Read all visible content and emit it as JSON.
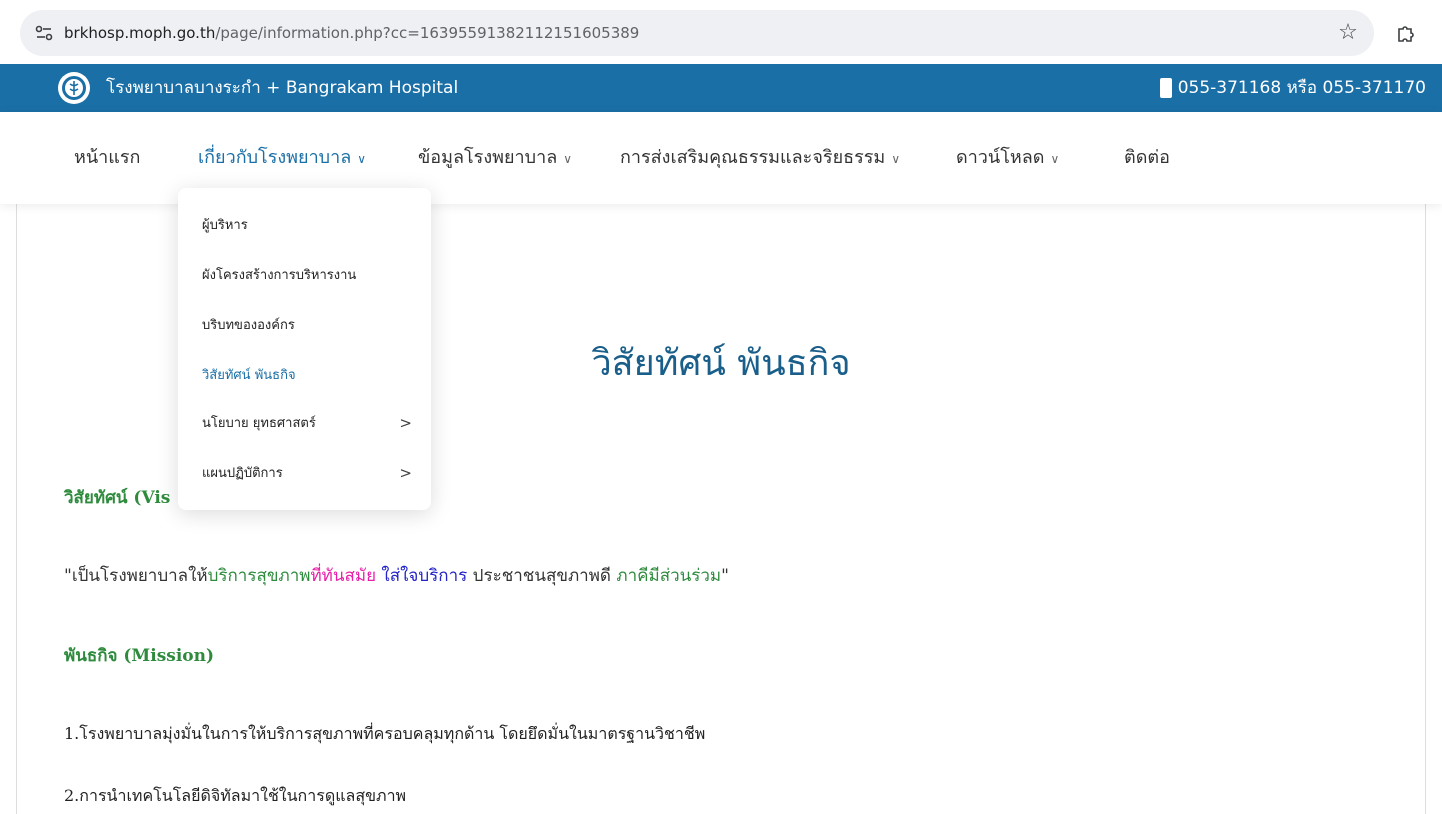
{
  "browser": {
    "url_host": "brkhosp.moph.go.th",
    "url_path": "/page/information.php?cc=1639559138211215160538​9"
  },
  "topbar": {
    "site_title": "โรงพยาบาลบางระกำ + Bangrakam Hospital",
    "phone": "055-371168 หรือ 055-371170"
  },
  "nav": {
    "items": [
      {
        "label": "หน้าแรก"
      },
      {
        "label": "เกี่ยวกับโรงพยาบาล"
      },
      {
        "label": "ข้อมูลโรงพยาบาล"
      },
      {
        "label": "การส่งเสริมคุณธรรมและจริยธรรม"
      },
      {
        "label": "ดาวน์โหลด"
      },
      {
        "label": "ติดต่อ"
      }
    ],
    "chevron": "∨"
  },
  "dropdown": {
    "items": [
      {
        "label": "ผู้บริหาร"
      },
      {
        "label": "ผังโครงสร้างการบริหารงาน"
      },
      {
        "label": "บริบทขององค์กร"
      },
      {
        "label": "วิสัยทัศน์ พันธกิจ"
      },
      {
        "label": "นโยบาย ยุทธศาสตร์"
      },
      {
        "label": "แผนปฏิบัติการ"
      }
    ],
    "submenu_arrow": ">"
  },
  "content": {
    "page_title": "วิสัยทัศน์ พันธกิจ",
    "vision_heading": "วิสัยทัศน์ (Vis",
    "vision_quote": {
      "q_open": "\"",
      "p1": "เป็นโรงพยาบาลให้",
      "p2": "บริการสุขภาพ",
      "p3": "ที่ทันสมัย",
      "p4": " ใส่ใจบริการ",
      "p5": " ประชาชนสุขภาพดี",
      "p6": " ภาคีมีส่วนร่วม",
      "q_close": "\""
    },
    "mission_heading": "พันธกิจ (Mission)",
    "mission_items": [
      "1.โรงพยาบาลมุ่งมั่นในการให้บริการสุขภาพที่ครอบคลุมทุกด้าน โดยยึดมั่นในมาตรฐานวิชาชีพ",
      "2.การนำเทคโนโลยีดิจิทัลมาใช้ในการดูแลสุขภาพ"
    ]
  },
  "colors": {
    "brand": "#1a6fa6",
    "green": "#2e8b3d",
    "pink": "#e91ea8",
    "blue": "#2323c8"
  }
}
